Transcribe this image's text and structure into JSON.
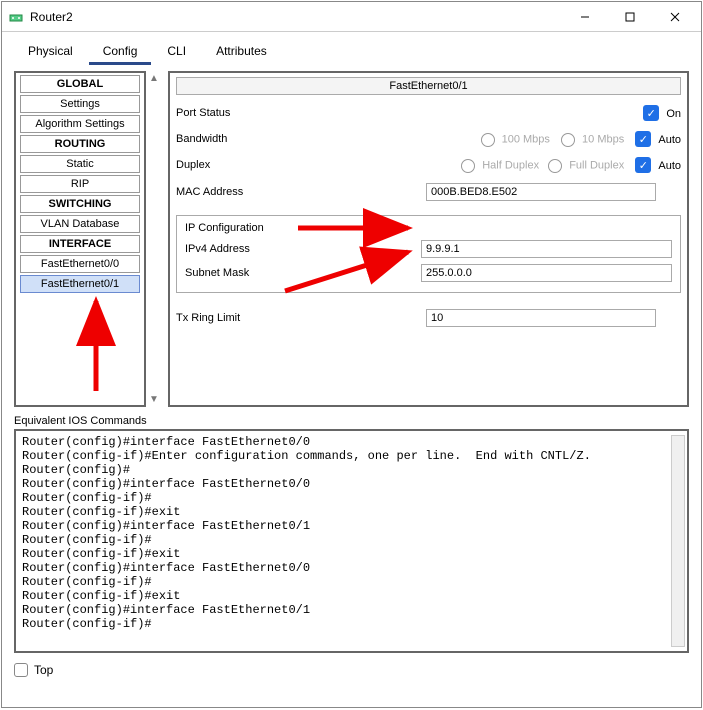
{
  "window": {
    "title": "Router2"
  },
  "tabs": {
    "physical": "Physical",
    "config": "Config",
    "cli": "CLI",
    "attributes": "Attributes"
  },
  "sidebar": {
    "groups": {
      "global": "GLOBAL",
      "routing": "ROUTING",
      "switching": "SWITCHING",
      "interface": "INTERFACE"
    },
    "items": {
      "settings": "Settings",
      "algorithm_settings": "Algorithm Settings",
      "static": "Static",
      "rip": "RIP",
      "vlan_db": "VLAN Database",
      "fe00": "FastEthernet0/0",
      "fe01": "FastEthernet0/1"
    }
  },
  "detail": {
    "title": "FastEthernet0/1",
    "port_status_label": "Port Status",
    "port_status_value": "On",
    "bandwidth_label": "Bandwidth",
    "bw_100": "100 Mbps",
    "bw_10": "10 Mbps",
    "bw_auto": "Auto",
    "duplex_label": "Duplex",
    "duplex_half": "Half Duplex",
    "duplex_full": "Full Duplex",
    "duplex_auto": "Auto",
    "mac_label": "MAC Address",
    "mac_value": "000B.BED8.E502",
    "ipcfg": "IP Configuration",
    "ipv4_label": "IPv4 Address",
    "ipv4_value": "9.9.9.1",
    "mask_label": "Subnet Mask",
    "mask_value": "255.0.0.0",
    "txring_label": "Tx Ring Limit",
    "txring_value": "10"
  },
  "ios_section_label": "Equivalent IOS Commands",
  "console_lines": [
    "Router(config)#interface FastEthernet0/0",
    "Router(config-if)#Enter configuration commands, one per line.  End with CNTL/Z.",
    "Router(config)#",
    "Router(config)#interface FastEthernet0/0",
    "Router(config-if)#",
    "Router(config-if)#exit",
    "Router(config)#interface FastEthernet0/1",
    "Router(config-if)#",
    "Router(config-if)#exit",
    "Router(config)#interface FastEthernet0/0",
    "Router(config-if)#",
    "Router(config-if)#exit",
    "Router(config)#interface FastEthernet0/1",
    "Router(config-if)#"
  ],
  "footer": {
    "top": "Top"
  }
}
